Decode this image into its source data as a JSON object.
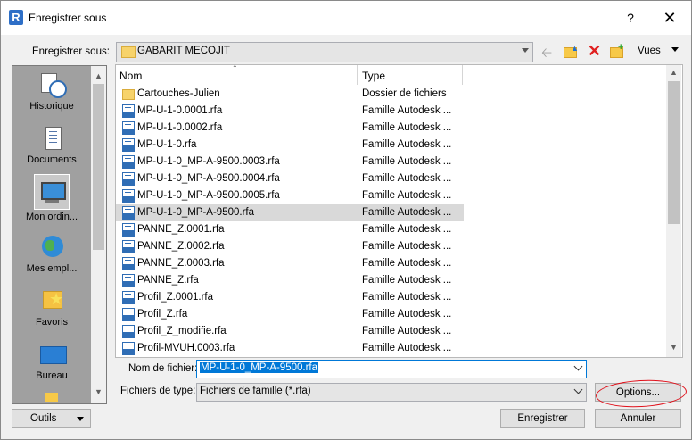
{
  "window": {
    "app_icon_letter": "R",
    "title": "Enregistrer sous",
    "help_label": "?",
    "close_label": "✕"
  },
  "location": {
    "label": "Enregistrer sous:",
    "current_folder": "GABARIT MECOJIT"
  },
  "toolbar": {
    "back_icon": "back-arrow-icon",
    "up_icon": "up-folder-icon",
    "delete_icon": "delete-icon",
    "new_folder_icon": "new-folder-icon",
    "views_label": "Vues"
  },
  "places": [
    {
      "label": "Historique",
      "icon": "history-icon"
    },
    {
      "label": "Documents",
      "icon": "documents-icon"
    },
    {
      "label": "Mon ordin...",
      "icon": "computer-icon",
      "selected": true
    },
    {
      "label": "Mes empl...",
      "icon": "network-icon"
    },
    {
      "label": "Favoris",
      "icon": "favorites-icon"
    },
    {
      "label": "Bureau",
      "icon": "desktop-icon"
    }
  ],
  "file_list": {
    "columns": {
      "name": "Nom",
      "type": "Type"
    },
    "rows": [
      {
        "name": "Cartouches-Julien",
        "type": "Dossier de fichiers",
        "kind": "folder"
      },
      {
        "name": "MP-U-1-0.0001.rfa",
        "type": "Famille Autodesk ...",
        "kind": "rfa"
      },
      {
        "name": "MP-U-1-0.0002.rfa",
        "type": "Famille Autodesk ...",
        "kind": "rfa"
      },
      {
        "name": "MP-U-1-0.rfa",
        "type": "Famille Autodesk ...",
        "kind": "rfa"
      },
      {
        "name": "MP-U-1-0_MP-A-9500.0003.rfa",
        "type": "Famille Autodesk ...",
        "kind": "rfa"
      },
      {
        "name": "MP-U-1-0_MP-A-9500.0004.rfa",
        "type": "Famille Autodesk ...",
        "kind": "rfa"
      },
      {
        "name": "MP-U-1-0_MP-A-9500.0005.rfa",
        "type": "Famille Autodesk ...",
        "kind": "rfa"
      },
      {
        "name": "MP-U-1-0_MP-A-9500.rfa",
        "type": "Famille Autodesk ...",
        "kind": "rfa",
        "selected": true
      },
      {
        "name": "PANNE_Z.0001.rfa",
        "type": "Famille Autodesk ...",
        "kind": "rfa"
      },
      {
        "name": "PANNE_Z.0002.rfa",
        "type": "Famille Autodesk ...",
        "kind": "rfa"
      },
      {
        "name": "PANNE_Z.0003.rfa",
        "type": "Famille Autodesk ...",
        "kind": "rfa"
      },
      {
        "name": "PANNE_Z.rfa",
        "type": "Famille Autodesk ...",
        "kind": "rfa"
      },
      {
        "name": "Profil_Z.0001.rfa",
        "type": "Famille Autodesk ...",
        "kind": "rfa"
      },
      {
        "name": "Profil_Z.rfa",
        "type": "Famille Autodesk ...",
        "kind": "rfa"
      },
      {
        "name": "Profil_Z_modifie.rfa",
        "type": "Famille Autodesk ...",
        "kind": "rfa"
      },
      {
        "name": "Profil-MVUH.0003.rfa",
        "type": "Famille Autodesk ...",
        "kind": "rfa"
      }
    ]
  },
  "filename": {
    "label": "Nom de fichier:",
    "value": "MP-U-1-0_MP-A-9500.rfa"
  },
  "filetype": {
    "label": "Fichiers de type:",
    "value": "Fichiers de famille  (*.rfa)"
  },
  "buttons": {
    "tools": "Outils",
    "options": "Options...",
    "save": "Enregistrer",
    "cancel": "Annuler"
  },
  "colors": {
    "selection": "#0078d7",
    "annotation_ring": "#e0101a",
    "rfa_icon": "#2f6db5"
  }
}
